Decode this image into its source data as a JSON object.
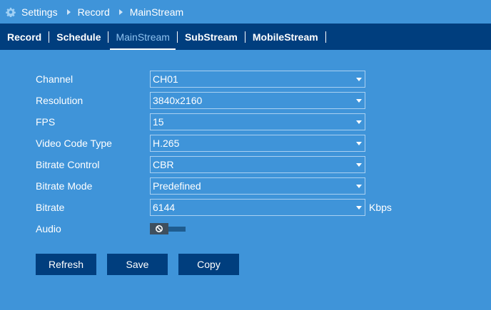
{
  "breadcrumb": {
    "items": [
      "Settings",
      "Record",
      "MainStream"
    ]
  },
  "tabs": [
    {
      "label": "Record",
      "active": false
    },
    {
      "label": "Schedule",
      "active": false
    },
    {
      "label": "MainStream",
      "active": true
    },
    {
      "label": "SubStream",
      "active": false
    },
    {
      "label": "MobileStream",
      "active": false
    }
  ],
  "form": {
    "channel": {
      "label": "Channel",
      "value": "CH01"
    },
    "resolution": {
      "label": "Resolution",
      "value": "3840x2160"
    },
    "fps": {
      "label": "FPS",
      "value": "15"
    },
    "video_code_type": {
      "label": "Video Code Type",
      "value": "H.265"
    },
    "bitrate_control": {
      "label": "Bitrate Control",
      "value": "CBR"
    },
    "bitrate_mode": {
      "label": "Bitrate Mode",
      "value": "Predefined"
    },
    "bitrate": {
      "label": "Bitrate",
      "value": "6144",
      "unit": "Kbps"
    },
    "audio": {
      "label": "Audio",
      "enabled": false
    }
  },
  "buttons": {
    "refresh": "Refresh",
    "save": "Save",
    "copy": "Copy"
  },
  "icons": {
    "breadcrumb": "gear-icon",
    "crumb_separator": "chevron-right-icon",
    "select_caret": "caret-down-icon",
    "audio_toggle": "disabled-icon"
  },
  "colors": {
    "background": "#3f94d9",
    "bar": "#003e7e",
    "active_tab": "#8ec2f0",
    "text": "#ffffff"
  }
}
